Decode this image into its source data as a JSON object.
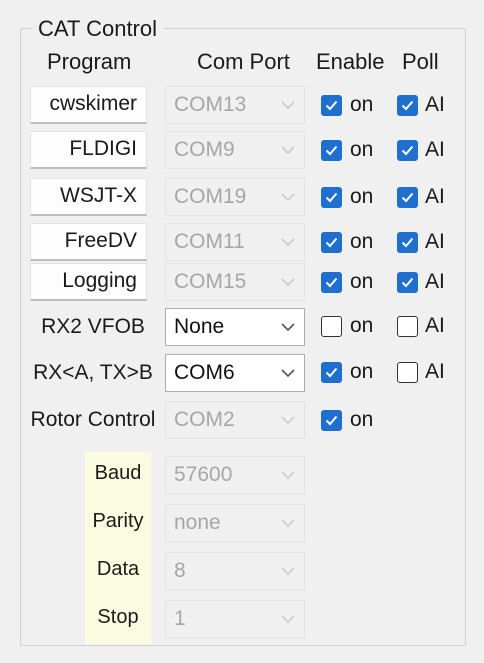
{
  "group": {
    "title": "CAT Control"
  },
  "headers": {
    "program": "Program",
    "com_port": "Com Port",
    "enable": "Enable",
    "poll": "Poll"
  },
  "programs": [
    {
      "name": "cwskimer",
      "port": "COM13",
      "enable_label": "on",
      "enable_checked": true,
      "poll_label": "AI",
      "poll_checked": true
    },
    {
      "name": "FLDIGI",
      "port": "COM9",
      "enable_label": "on",
      "enable_checked": true,
      "poll_label": "AI",
      "poll_checked": true
    },
    {
      "name": "WSJT-X",
      "port": "COM19",
      "enable_label": "on",
      "enable_checked": true,
      "poll_label": "AI",
      "poll_checked": true
    },
    {
      "name": "FreeDV",
      "port": "COM11",
      "enable_label": "on",
      "enable_checked": true,
      "poll_label": "AI",
      "poll_checked": true
    },
    {
      "name": "Logging",
      "port": "COM15",
      "enable_label": "on",
      "enable_checked": true,
      "poll_label": "AI",
      "poll_checked": true
    }
  ],
  "rx2_vfob": {
    "label": "RX2 VFOB",
    "port": "None",
    "enable_label": "on",
    "enable_checked": false,
    "poll_label": "AI",
    "poll_checked": false
  },
  "rxa_txb": {
    "label": "RX<A, TX>B",
    "port": "COM6",
    "enable_label": "on",
    "enable_checked": true,
    "poll_label": "AI",
    "poll_checked": false
  },
  "rotor": {
    "label": "Rotor Control",
    "port": "COM2",
    "enable_label": "on",
    "enable_checked": true
  },
  "serial": {
    "baud_label": "Baud",
    "baud": "57600",
    "parity_label": "Parity",
    "parity": "none",
    "data_label": "Data",
    "data": "8",
    "stop_label": "Stop",
    "stop": "1"
  },
  "colors": {
    "checkbox_checked": "#1f6fcf",
    "serial_label_bg": "#fbfbe0"
  }
}
